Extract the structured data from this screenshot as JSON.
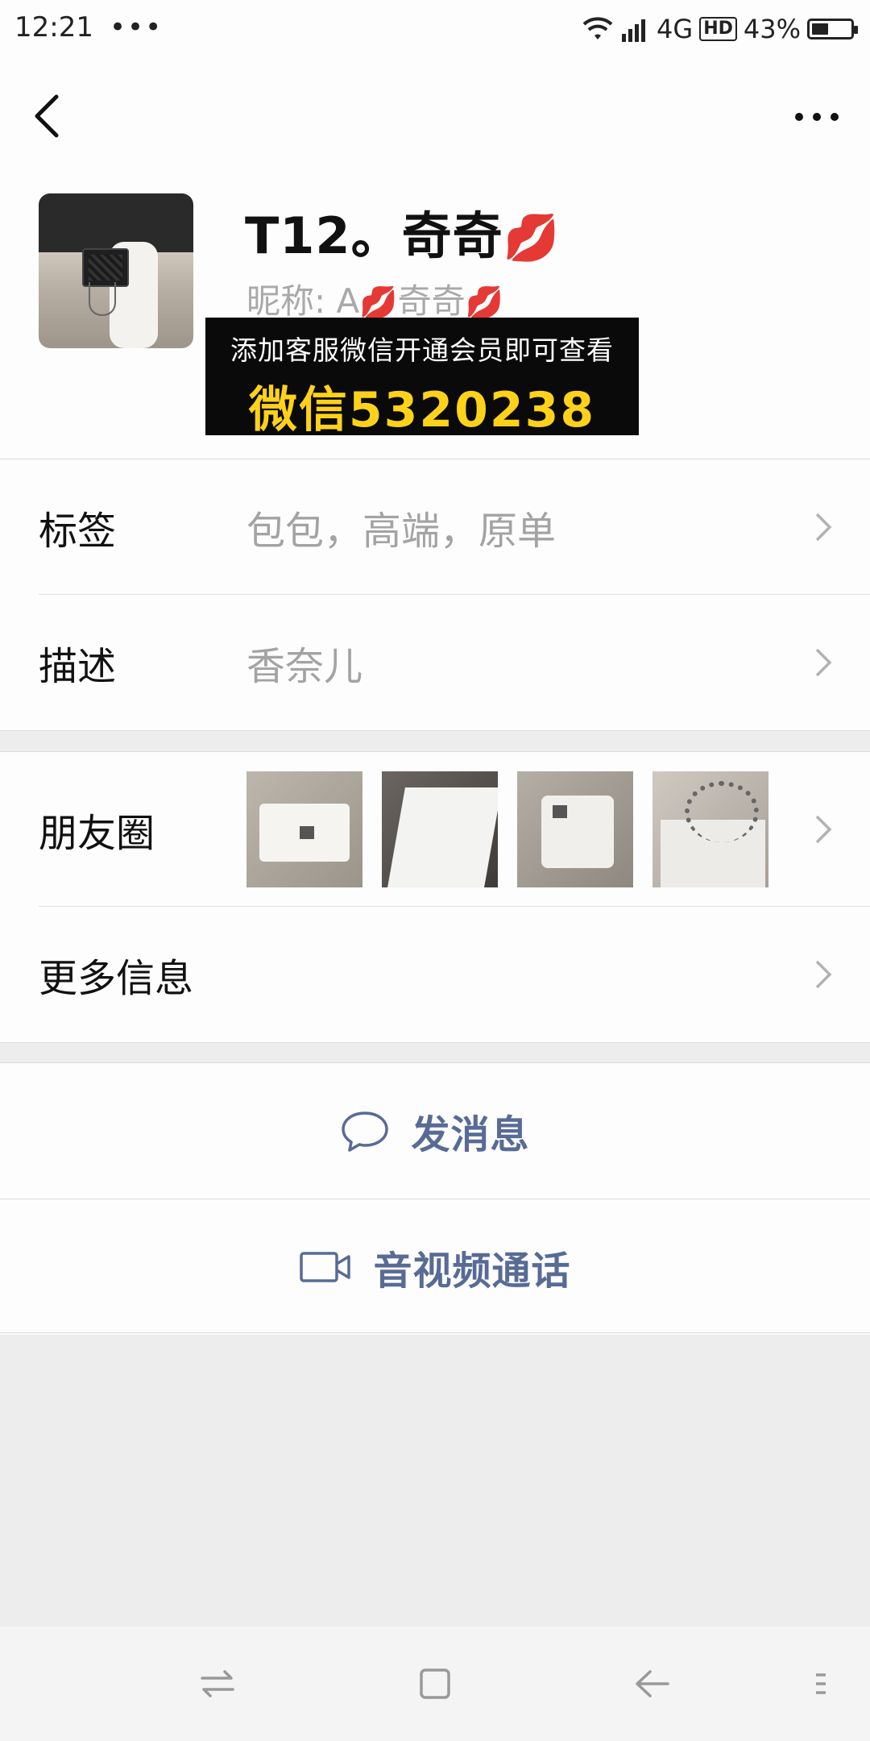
{
  "status_bar": {
    "time": "12:21",
    "dots": "•••",
    "network": "4G",
    "hd": "HD",
    "battery_percent": "43%",
    "battery_level": 0.43
  },
  "navbar": {
    "back_icon": "chevron-left-icon",
    "more_icon": "more-dots-icon"
  },
  "profile": {
    "display_name": "T12。奇奇",
    "name_emoji": "💋",
    "nickname_prefix": "昵称: A",
    "nickname_mid": "奇奇",
    "nickname_emoji": "💋"
  },
  "promo": {
    "line1": "添加客服微信开通会员即可查看",
    "line2": "微信5320238"
  },
  "rows": {
    "tags": {
      "label": "标签",
      "value": "包包，高端，原单"
    },
    "description": {
      "label": "描述",
      "value": "香奈儿"
    },
    "moments": {
      "label": "朋友圈"
    },
    "more_info": {
      "label": "更多信息"
    }
  },
  "actions": {
    "message": {
      "label": "发消息",
      "icon": "chat-bubble-icon"
    },
    "call": {
      "label": "音视频通话",
      "icon": "video-camera-icon"
    }
  },
  "colors": {
    "accent": "#576b95",
    "promo_yellow": "#ffd21a",
    "lips_red": "#d41c3a"
  }
}
